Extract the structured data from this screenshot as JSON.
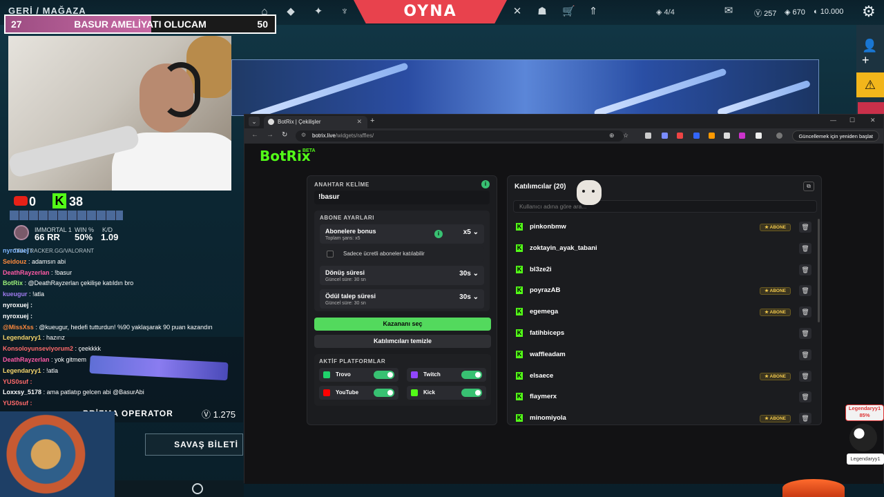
{
  "game": {
    "nav_back": "GERİ / MAĞAZA",
    "play_label": "OYNA",
    "rank_count": "4/4",
    "currencies": [
      {
        "icon": "valorant-points-icon",
        "value": "257"
      },
      {
        "icon": "radianite-icon",
        "value": "670"
      },
      {
        "icon": "kingdom-credits-icon",
        "value": "10.000"
      }
    ],
    "banner_alt": "",
    "weapon_name": "PRİZMA OPERATOR",
    "weapon_price": "1.275",
    "battlepass_label": "SAVAŞ BİLETİ"
  },
  "stream": {
    "goal": {
      "left": "27",
      "title": "BASUR AMELİYATI OLUCAM",
      "right": "50",
      "progress": 0.54
    },
    "youtube_count": "0",
    "kick_count": "38",
    "rank": {
      "tier": "IMMORTAL 1",
      "rr": "66 RR",
      "win_label": "WIN %",
      "win": "50%",
      "kd_label": "K/D",
      "kd": "1.09"
    },
    "tracker": "TRN  TRACKER.GG/VALORANT",
    "chat": [
      {
        "user": "nyroxuej :",
        "msg": "",
        "color": "blue"
      },
      {
        "user": "Seidouz",
        "msg": ": adamsın abi",
        "color": "orange"
      },
      {
        "user": "DeathRayzerlan",
        "msg": ": !basur",
        "color": "pink"
      },
      {
        "user": "BotRix",
        "msg": ": @DeathRayzerlan çekilişe katıldın bro",
        "color": "green"
      },
      {
        "user": "kueugur",
        "msg": ": !atla",
        "color": "purple"
      },
      {
        "user": "nyroxuej :",
        "msg": "",
        "color": "white"
      },
      {
        "user": "nyroxuej :",
        "msg": "",
        "color": "white"
      },
      {
        "user": "@MissXss",
        "msg": ": @kueugur, hedefi tutturdun! %90 yaklaşarak 90 puan kazandın",
        "color": "orange"
      },
      {
        "user": "Legendaryy1",
        "msg": ": hazırız",
        "color": "yellow"
      },
      {
        "user": "Konsoloyunseviyorum2",
        "msg": ": çeekkkk",
        "color": "red"
      },
      {
        "user": "DeathRayzerlan",
        "msg": ": yok gitmem",
        "color": "pink"
      },
      {
        "user": "Legendaryy1",
        "msg": ": !atla",
        "color": "yellow"
      },
      {
        "user": "YUS0suf :",
        "msg": "",
        "color": "red"
      },
      {
        "user": "Loxxsy_5178",
        "msg": ": ama patlatıp gelcen abi @BasurAbi",
        "color": "white"
      },
      {
        "user": "YUS0suf :",
        "msg": "",
        "color": "red"
      }
    ],
    "alert": {
      "user": "Legendaryy1",
      "percent": "85%",
      "name_tag": "Legendaryy1"
    }
  },
  "browser": {
    "tab_title": "BotRix | Çekilişler",
    "url_host": "botrix.live",
    "url_path": "/widgets/raffles/",
    "update_label": "Güncellemek için yeniden başlat"
  },
  "botrix": {
    "brand": "BotRix",
    "beta": "BETA",
    "keyword_title": "ANAHTAR KELİME",
    "keyword_value": "!basur",
    "sub_title": "ABONE AYARLARI",
    "sub_bonus": {
      "title": "Abonelere bonus",
      "sub": "Toplam şans: x5",
      "value": "x5"
    },
    "only_paid": "Sadece ücretli aboneler katılabilir",
    "duration": {
      "title": "Dönüş süresi",
      "sub": "Güncel süre: 30 sn",
      "value": "30s"
    },
    "claim": {
      "title": "Ödül talep süresi",
      "sub": "Güncel süre: 30 sn",
      "value": "30s"
    },
    "pick_winner": "Kazananı seç",
    "clear_participants": "Katılımcıları temizle",
    "platforms_title": "AKTİF PLATFORMLAR",
    "platforms": [
      {
        "name": "Trovo",
        "color": "#1fd26b",
        "on": true
      },
      {
        "name": "Twitch",
        "color": "#9146ff",
        "on": true
      },
      {
        "name": "YouTube",
        "color": "#ff0000",
        "on": true
      },
      {
        "name": "Kick",
        "color": "#53fc18",
        "on": true
      }
    ],
    "participants_title": "Katılımcılar (20)",
    "search_placeholder": "Kullanıcı adına göre ara...",
    "abone_label": "ABONE",
    "participants": [
      {
        "name": "pinkonbmw",
        "abone": true
      },
      {
        "name": "zoktayin_ayak_tabani",
        "abone": false
      },
      {
        "name": "bl3ze2i",
        "abone": false
      },
      {
        "name": "poyrazAB",
        "abone": true
      },
      {
        "name": "egemega",
        "abone": true
      },
      {
        "name": "fatihbiceps",
        "abone": false
      },
      {
        "name": "waffleadam",
        "abone": false
      },
      {
        "name": "elsaece",
        "abone": true
      },
      {
        "name": "flaymerx",
        "abone": false
      },
      {
        "name": "minomiyola",
        "abone": true
      }
    ]
  }
}
